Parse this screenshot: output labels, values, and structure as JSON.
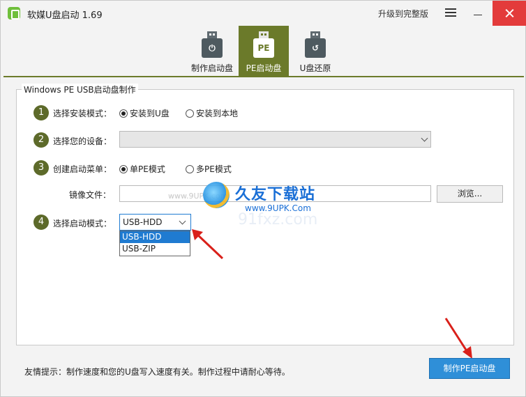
{
  "window": {
    "title": "软媒U盘启动 1.69",
    "upgrade_label": "升级到完整版"
  },
  "tabs": [
    {
      "label": "制作启动盘",
      "icon": "usb-power-icon",
      "icon_text": ""
    },
    {
      "label": "PE启动盘",
      "icon": "usb-pe-icon",
      "icon_text": "PE",
      "active": true
    },
    {
      "label": "U盘还原",
      "icon": "usb-restore-icon",
      "icon_text": ""
    }
  ],
  "panel": {
    "title": "Windows PE USB启动盘制作",
    "step1": {
      "num": "1",
      "label": "选择安装模式：",
      "opt_usb": "安装到U盘",
      "opt_local": "安装到本地",
      "selected": "usb"
    },
    "step2": {
      "num": "2",
      "label": "选择您的设备：",
      "value": ""
    },
    "step3": {
      "num": "3",
      "label": "创建启动菜单：",
      "opt_single": "单PE模式",
      "opt_multi": "多PE模式",
      "selected": "single"
    },
    "image": {
      "label": "镜像文件：",
      "value": "",
      "browse_label": "浏览..."
    },
    "step4": {
      "num": "4",
      "label": "选择启动模式：",
      "value": "USB-HDD",
      "options": [
        "USB-HDD",
        "USB-ZIP"
      ],
      "highlighted": "USB-HDD"
    }
  },
  "watermark": {
    "name": "久友下载站",
    "url": "www.9UPK.Com",
    "left_text": "www.9UPK.com",
    "faint_text": "91fxz.com"
  },
  "footer": {
    "tip": "友情提示：制作速度和您的U盘写入速度有关。制作过程中请耐心等待。",
    "make_button": "制作PE启动盘"
  },
  "colors": {
    "accent": "#6b7a2a",
    "step_badge": "#5d6a2a",
    "close": "#e33b3b",
    "primary_button": "#2f8fd8",
    "arrow": "#d9201a"
  }
}
